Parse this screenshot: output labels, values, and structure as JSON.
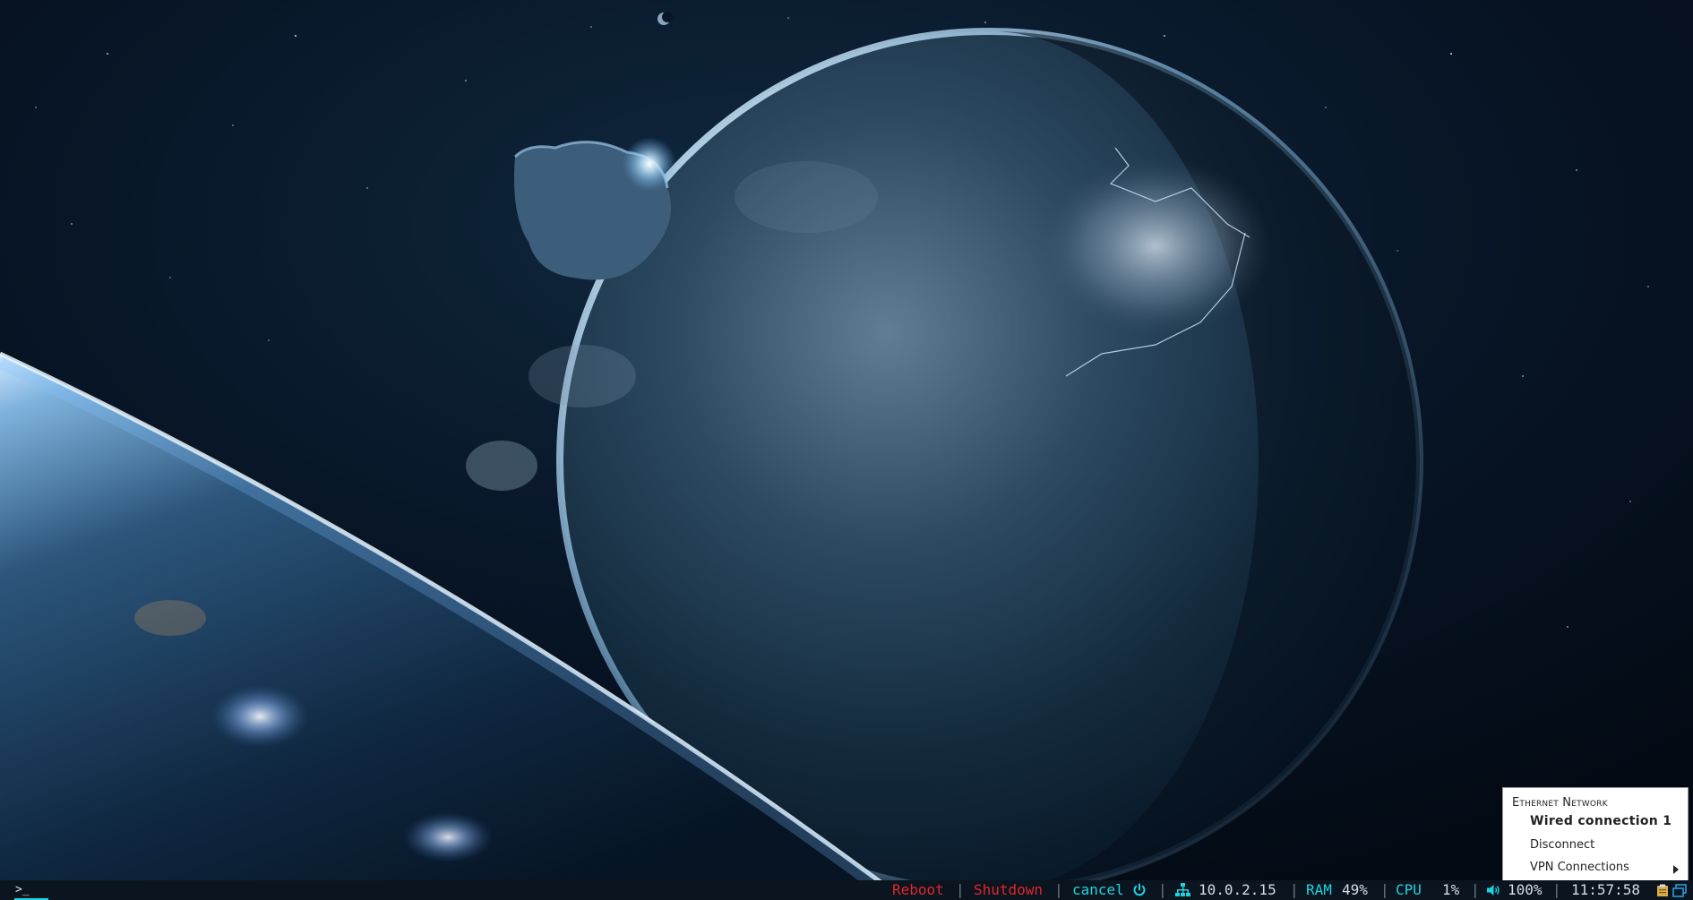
{
  "taskbar": {
    "launcher_icon": "terminal-prompt-icon",
    "reboot_label": "Reboot",
    "shutdown_label": "Shutdown",
    "cancel_label": "cancel",
    "power_icon": "power-icon",
    "network_icon": "network-tree-icon",
    "ip_address": "10.0.2.15",
    "ram_label": "RAM",
    "ram_value": "49%",
    "cpu_label": "CPU",
    "cpu_value": "1%",
    "volume_icon": "speaker-icon",
    "volume_value": "100%",
    "clock": "11:57:58",
    "separator": "|",
    "tray_icons": [
      "clipboard-icon",
      "window-icon"
    ]
  },
  "network_menu": {
    "header": "Ethernet Network",
    "items": [
      {
        "label": "Wired connection 1",
        "active": true
      },
      {
        "label": "Disconnect",
        "active": false
      },
      {
        "label": "VPN Connections",
        "active": false,
        "submenu": true
      }
    ]
  },
  "colors": {
    "accent": "#1fd2e0",
    "danger": "#e2252b",
    "bar_bg": "#0b1520"
  }
}
